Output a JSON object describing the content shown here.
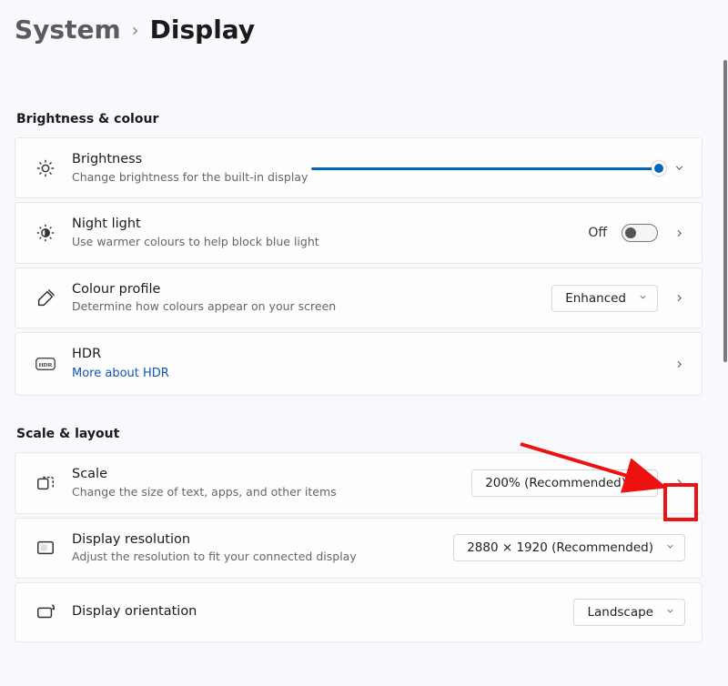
{
  "breadcrumb": {
    "parent": "System",
    "current": "Display"
  },
  "sections": {
    "brightness": {
      "heading": "Brightness & colour",
      "brightness": {
        "title": "Brightness",
        "desc": "Change brightness for the built-in display",
        "value_pct": 100
      },
      "night_light": {
        "title": "Night light",
        "desc": "Use warmer colours to help block blue light",
        "state_label": "Off",
        "on": false
      },
      "colour_profile": {
        "title": "Colour profile",
        "desc": "Determine how colours appear on your screen",
        "selected": "Enhanced"
      },
      "hdr": {
        "title": "HDR",
        "link": "More about HDR"
      }
    },
    "scale": {
      "heading": "Scale & layout",
      "scale": {
        "title": "Scale",
        "desc": "Change the size of text, apps, and other items",
        "selected": "200% (Recommended)"
      },
      "resolution": {
        "title": "Display resolution",
        "desc": "Adjust the resolution to fit your connected display",
        "selected": "2880 × 1920 (Recommended)"
      },
      "orientation": {
        "title": "Display orientation",
        "selected": "Landscape"
      }
    }
  },
  "annotation": {
    "target": "scale-expand-chevron",
    "highlight_color": "#e11"
  }
}
